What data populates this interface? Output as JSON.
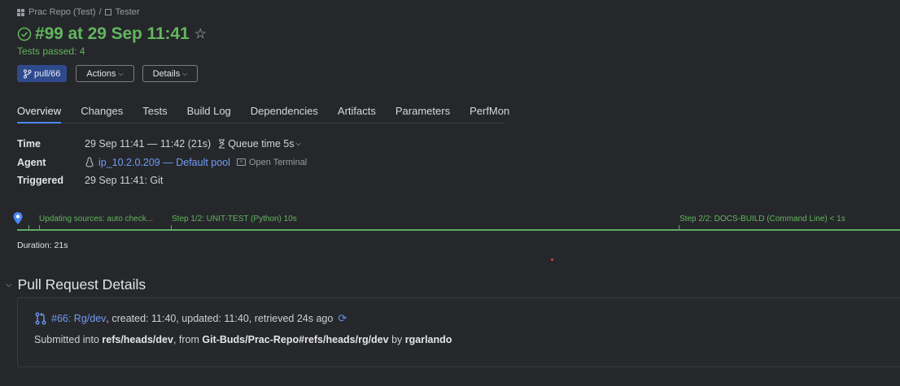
{
  "breadcrumb": {
    "project": "Prac Repo (Test)",
    "separator": "/",
    "build_config": "Tester"
  },
  "build": {
    "title": "#99 at 29 Sep 11:41",
    "status_text": "Tests passed: 4"
  },
  "buttons": {
    "branch": "pull/66",
    "actions": "Actions",
    "details": "Details"
  },
  "tabs": [
    {
      "label": "Overview",
      "active": true
    },
    {
      "label": "Changes"
    },
    {
      "label": "Tests"
    },
    {
      "label": "Build Log"
    },
    {
      "label": "Dependencies"
    },
    {
      "label": "Artifacts"
    },
    {
      "label": "Parameters"
    },
    {
      "label": "PerfMon"
    }
  ],
  "info": {
    "time_label": "Time",
    "time_value": "29 Sep 11:41 — 11:42 (21s)",
    "queue_time": "Queue time 5s",
    "agent_label": "Agent",
    "agent_value": "ip_10.2.0.209 — Default pool",
    "open_terminal": "Open Terminal",
    "triggered_label": "Triggered",
    "triggered_value": "29 Sep 11:41: Git"
  },
  "timeline": {
    "steps": [
      {
        "label": "Updating sources: auto check..."
      },
      {
        "label": "Step 1/2: UNIT-TEST (Python) 10s"
      },
      {
        "label": "Step 2/2: DOCS-BUILD (Command Line) < 1s"
      }
    ],
    "duration": "Duration: 21s"
  },
  "pull_request": {
    "section_title": "Pull Request Details",
    "pr_link": "#66: Rg/dev",
    "pr_meta": ", created: 11:40, updated: 11:40, retrieved 24s ago",
    "submitted_prefix": "Submitted into ",
    "target_ref": "refs/heads/dev",
    "from_text": ", from ",
    "source_ref": "Git-Buds/Prac-Repo#refs/heads/rg/dev",
    "by_text": " by ",
    "author": "rgarlando"
  },
  "colors": {
    "background": "#26272b",
    "success": "#62b65e",
    "link": "#6f9df5",
    "accent": "#4a88f0",
    "branch_badge": "#2f4a8c"
  }
}
